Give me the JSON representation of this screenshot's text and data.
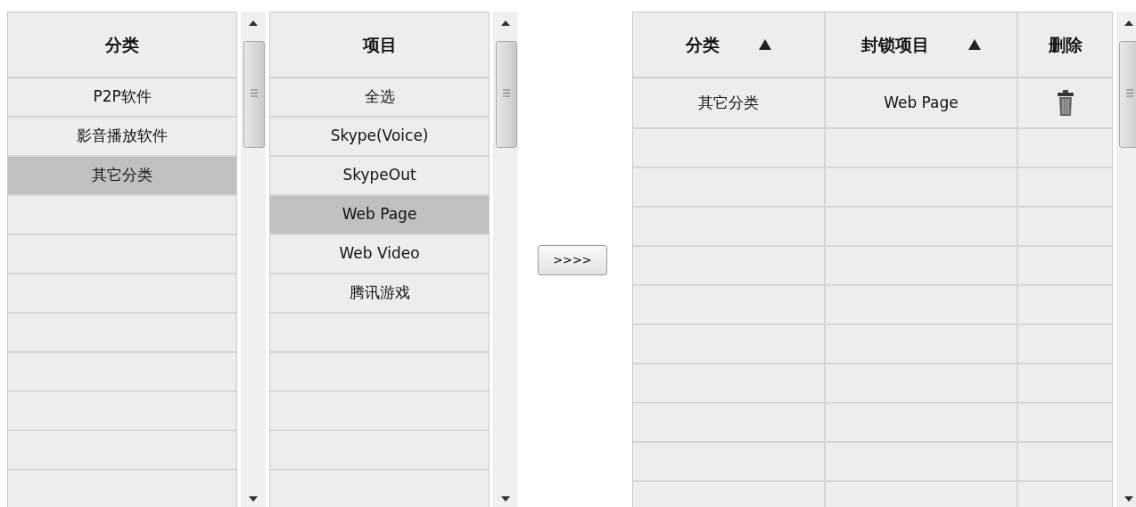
{
  "category_list": {
    "header": "分类",
    "items": [
      {
        "label": "P2P软件",
        "selected": false
      },
      {
        "label": "影音播放软件",
        "selected": false
      },
      {
        "label": "其它分类",
        "selected": true
      }
    ]
  },
  "item_list": {
    "header": "项目",
    "items": [
      {
        "label": "全选",
        "selected": false
      },
      {
        "label": "Skype(Voice)",
        "selected": false
      },
      {
        "label": "SkypeOut",
        "selected": false
      },
      {
        "label": "Web Page",
        "selected": true
      },
      {
        "label": "Web Video",
        "selected": false
      },
      {
        "label": "腾讯游戏",
        "selected": false
      }
    ]
  },
  "add_button": {
    "label": ">>>>"
  },
  "blocked_table": {
    "columns": [
      {
        "label": "分类",
        "sortable": true
      },
      {
        "label": "封锁项目",
        "sortable": true
      },
      {
        "label": "删除",
        "sortable": false
      }
    ],
    "rows": [
      {
        "category": "其它分类",
        "item": "Web Page"
      }
    ]
  }
}
